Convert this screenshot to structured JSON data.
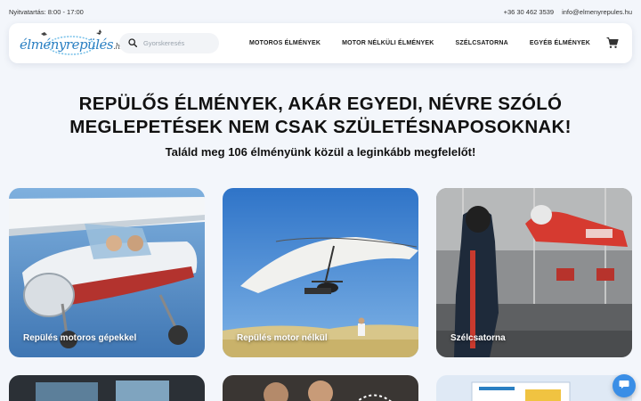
{
  "topbar": {
    "hours": "Nyitvatartás: 8:00 - 17:00",
    "phone": "+36 30 462 3539",
    "email": "info@elmenyrepules.hu"
  },
  "logo": {
    "text": "élményrepülés",
    "tld": ".hu"
  },
  "search": {
    "placeholder": "Gyorskeresés",
    "value": ""
  },
  "menu": [
    {
      "label": "MOTOROS ÉLMÉNYEK"
    },
    {
      "label": "MOTOR NÉLKÜLI ÉLMÉNYEK"
    },
    {
      "label": "SZÉLCSATORNA"
    },
    {
      "label": "EGYÉB ÉLMÉNYEK"
    }
  ],
  "hero": {
    "title_line1": "REPÜLŐS ÉLMÉNYEK, AKÁR EGYEDI, NÉVRE SZÓLÓ",
    "title_line2": "MEGLEPETÉSEK NEM CSAK SZÜLETÉSNAPOSOKNAK!",
    "subtitle": "Találd meg 106 élményünk közül a leginkább megfelelőt!"
  },
  "cards": [
    {
      "label": "Repülés motoros gépekkel"
    },
    {
      "label": "Repülés motor nélkül"
    },
    {
      "label": "Szélcsatorna"
    }
  ],
  "icons": {
    "search": "search-icon",
    "cart": "cart-icon",
    "chat": "chat-icon"
  },
  "colors": {
    "page_bg": "#f3f6fb",
    "brand_blue": "#2a7fc2",
    "chat_button": "#3a8ee6"
  }
}
